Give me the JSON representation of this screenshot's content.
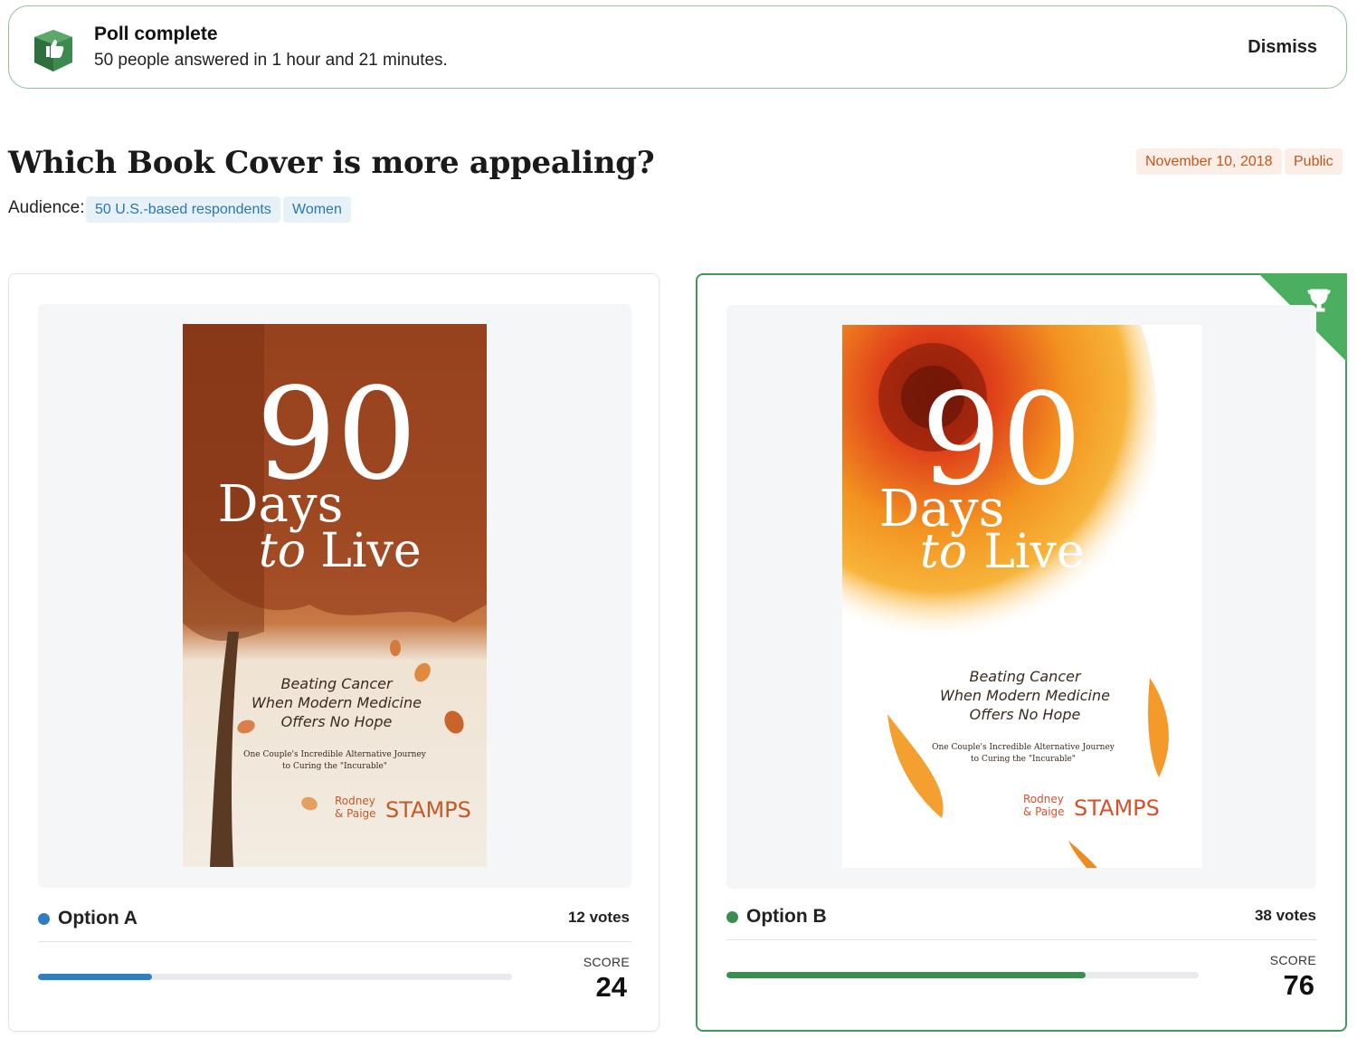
{
  "banner": {
    "title": "Poll complete",
    "subtitle": "50 people answered in 1 hour and 21 minutes.",
    "dismiss_label": "Dismiss",
    "icon": "thumbs-up-box-icon"
  },
  "poll": {
    "title": "Which Book Cover is more appealing?",
    "date": "November 10, 2018",
    "visibility": "Public",
    "audience_label": "Audience:",
    "audience_tags": [
      "50 U.S.-based respondents",
      "Women"
    ]
  },
  "options": [
    {
      "label": "Option A",
      "votes": "12 votes",
      "score_label": "SCORE",
      "score": "24",
      "score_fraction": 0.24,
      "color": "#2f7fc0",
      "winner": false,
      "cover": {
        "number": "90",
        "title1": "Days",
        "title2a": "to",
        "title2b": "Live",
        "subtitle": [
          "Beating Cancer",
          "When Modern Medicine",
          "Offers No Hope"
        ],
        "tagline": [
          "One Couple's Incredible Alternative Journey",
          "to Curing the \"Incurable\""
        ],
        "author_small": [
          "Rodney",
          "& Paige"
        ],
        "author_large": "STAMPS"
      }
    },
    {
      "label": "Option B",
      "votes": "38 votes",
      "score_label": "SCORE",
      "score": "76",
      "score_fraction": 0.76,
      "color": "#3a8f50",
      "winner": true,
      "cover": {
        "number": "90",
        "title1": "Days",
        "title2a": "to",
        "title2b": "Live",
        "subtitle": [
          "Beating Cancer",
          "When Modern Medicine",
          "Offers No Hope"
        ],
        "tagline": [
          "One Couple's Incredible Alternative Journey",
          "to Curing the \"Incurable\""
        ],
        "author_small": [
          "Rodney",
          "& Paige"
        ],
        "author_large": "STAMPS"
      }
    }
  ],
  "colors": {
    "banner_border": "#8fbf9c",
    "tag_orange_bg": "#fbeee6",
    "tag_orange_text": "#c4551e",
    "tag_blue_bg": "#e6f1f8",
    "tag_blue_text": "#2b76b2",
    "winner_green": "#4caf60"
  }
}
